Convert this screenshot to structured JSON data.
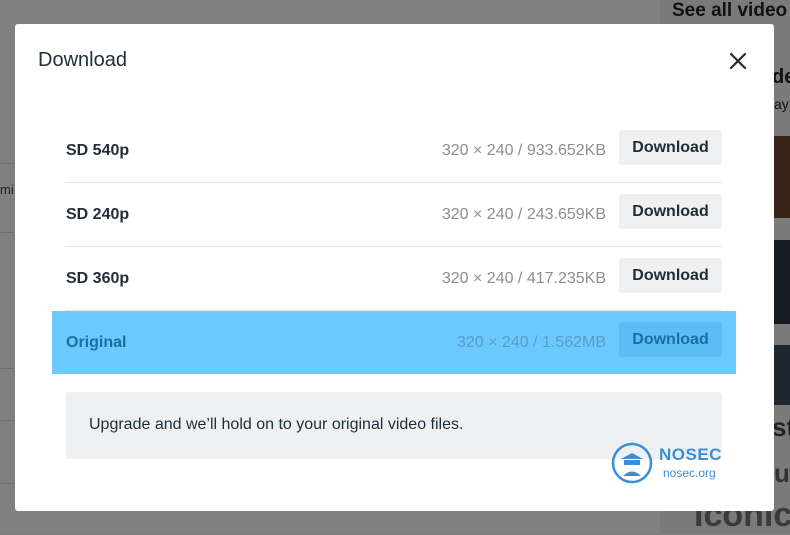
{
  "background": {
    "see_all": "See all video",
    "frag_de": "de",
    "frag_y": "ay",
    "frag_left": "mi",
    "frag_st": "st",
    "frag_us": "us",
    "frag_iconic": "Iconic"
  },
  "modal": {
    "title": "Download",
    "close_icon": "close-icon"
  },
  "rows": [
    {
      "label": "SD 540p",
      "meta": "320 × 240 / 933.652KB",
      "button": "Download",
      "selected": false
    },
    {
      "label": "SD 240p",
      "meta": "320 × 240 / 243.659KB",
      "button": "Download",
      "selected": false
    },
    {
      "label": "SD 360p",
      "meta": "320 × 240 / 417.235KB",
      "button": "Download",
      "selected": false
    },
    {
      "label": "Original",
      "meta": "320 × 240 / 1.562MB",
      "button": "Download",
      "selected": true
    }
  ],
  "upgrade_notice": "Upgrade and we’ll hold on to your original video files.",
  "watermark": {
    "name": "NOSEC",
    "url": "nosec.org"
  },
  "colors": {
    "accent": "#6ac9fe",
    "accent_text": "#1a6ea3",
    "text": "#1f2d3a",
    "muted": "#8a8f94",
    "button_bg": "#eef0f2"
  }
}
